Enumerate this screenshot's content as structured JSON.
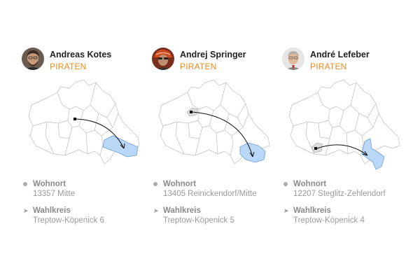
{
  "candidates": [
    {
      "name": "Andreas Kotes",
      "party": "PIRATEN",
      "wohnort_label": "Wohnort",
      "wohnort": "13357 Mitte",
      "wahlkreis_label": "Wahlkreis",
      "wahlkreis": "Treptow-Köpenick 6"
    },
    {
      "name": "Andrej Springer",
      "party": "PIRATEN",
      "wohnort_label": "Wohnort",
      "wohnort": "13405 Reinickendorf/Mitte",
      "wahlkreis_label": "Wahlkreis",
      "wahlkreis": "Treptow-Köpenick 5"
    },
    {
      "name": "André Lefeber",
      "party": "PIRATEN",
      "wohnort_label": "Wohnort",
      "wohnort": "12207 Steglitz-Zehlendorf",
      "wahlkreis_label": "Wahlkreis",
      "wahlkreis": "Treptow-Köpenick 4"
    }
  ],
  "colors": {
    "party": "#f08a1c",
    "district_fill": "#b9d8f7",
    "district_stroke": "#6a9fd6",
    "map_stroke": "#bdbdbd"
  }
}
